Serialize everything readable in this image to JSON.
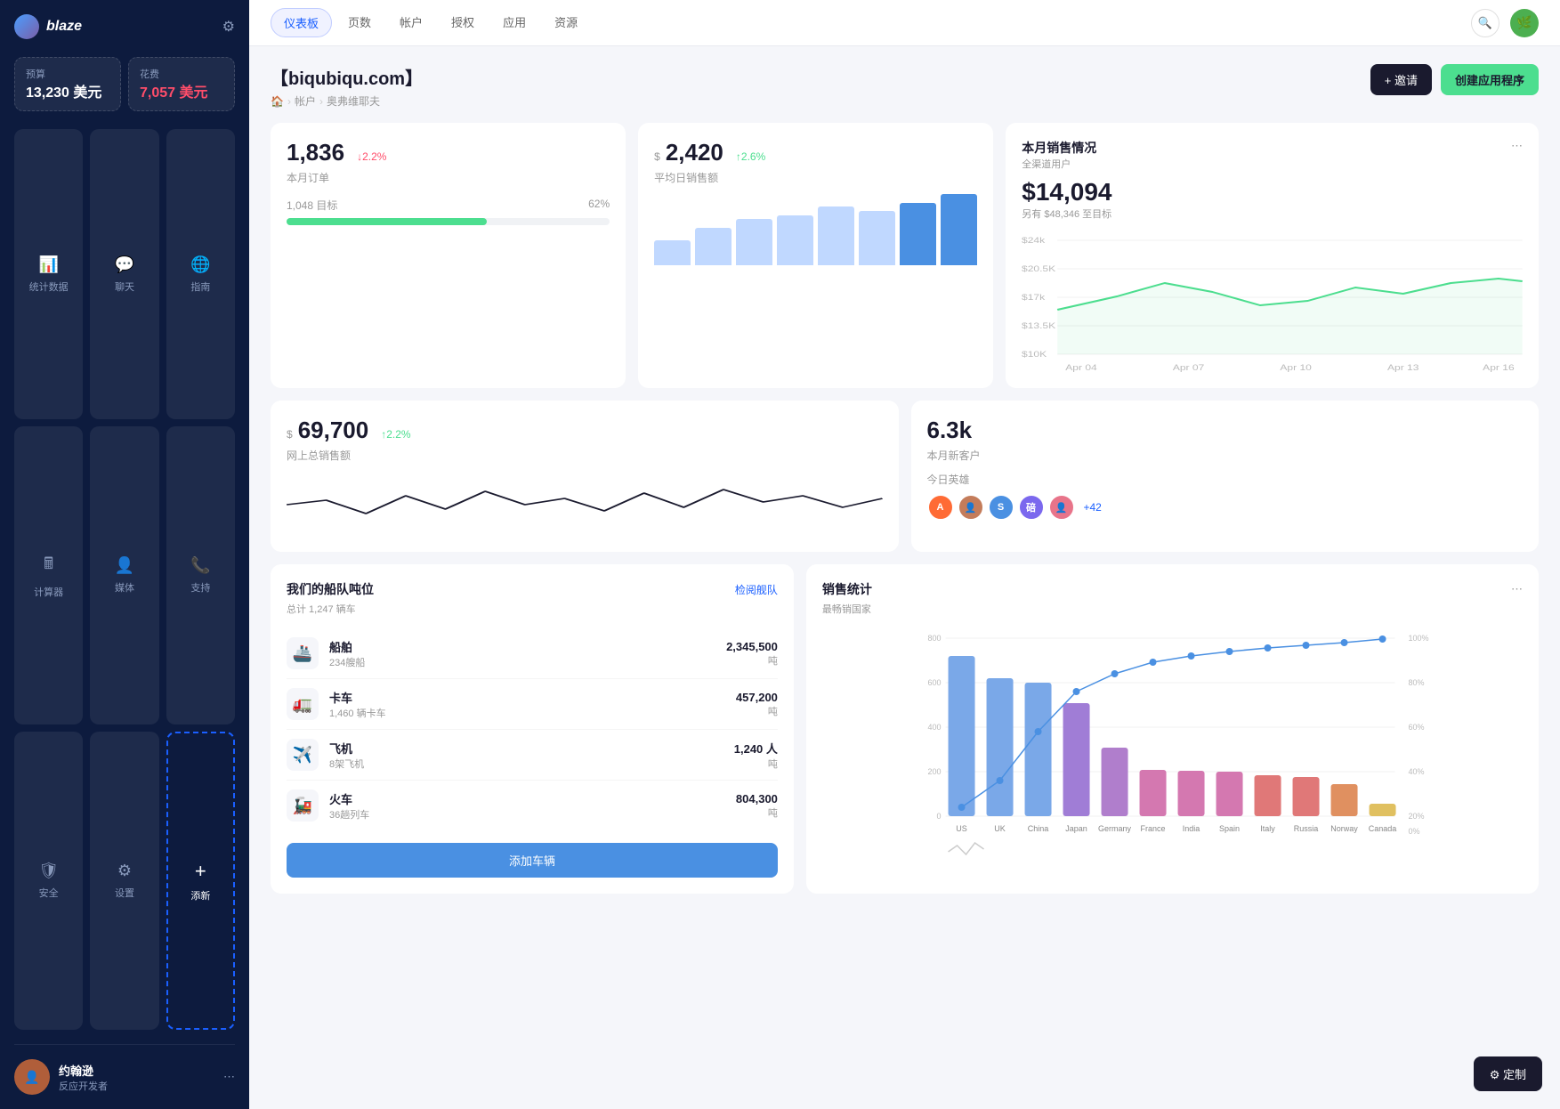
{
  "sidebar": {
    "logo_text": "blaze",
    "budget": {
      "label": "预算",
      "value": "13,230 美元"
    },
    "expense": {
      "label": "花费",
      "value": "7,057 美元"
    },
    "nav_items": [
      {
        "id": "stats",
        "label": "统计数据",
        "icon": "📊"
      },
      {
        "id": "chat",
        "label": "聊天",
        "icon": "💬"
      },
      {
        "id": "guide",
        "label": "指南",
        "icon": "🌐"
      },
      {
        "id": "calc",
        "label": "计算器",
        "icon": "🖩"
      },
      {
        "id": "media",
        "label": "媒体",
        "icon": "👤"
      },
      {
        "id": "support",
        "label": "支持",
        "icon": "📞"
      },
      {
        "id": "security",
        "label": "安全",
        "icon": "🛡"
      },
      {
        "id": "settings",
        "label": "设置",
        "icon": "⚙"
      },
      {
        "id": "add",
        "label": "添新",
        "icon": "+"
      }
    ],
    "user": {
      "name": "约翰逊",
      "role": "反应开发者"
    }
  },
  "topnav": {
    "tabs": [
      {
        "id": "dashboard",
        "label": "仪表板",
        "active": true
      },
      {
        "id": "pages",
        "label": "页数"
      },
      {
        "id": "accounts",
        "label": "帐户"
      },
      {
        "id": "auth",
        "label": "授权"
      },
      {
        "id": "apps",
        "label": "应用"
      },
      {
        "id": "resources",
        "label": "资源"
      }
    ]
  },
  "page": {
    "title": "【biqubiqu.com】",
    "breadcrumb": [
      "🏠",
      "帐户",
      "奥弗维耶夫"
    ],
    "actions": {
      "invite": "+ 邀请",
      "create": "创建应用程序"
    }
  },
  "stats": {
    "orders": {
      "value": "1,836",
      "change": "↓2.2%",
      "change_dir": "down",
      "label": "本月订单",
      "target_label": "1,048 目标",
      "target_pct": "62%",
      "bar_pct": 62
    },
    "avg_sales": {
      "prefix": "$",
      "value": "2,420",
      "change": "↑2.6%",
      "change_dir": "up",
      "label": "平均日销售额",
      "bars": [
        30,
        45,
        55,
        60,
        70,
        65,
        75,
        85
      ]
    },
    "monthly_sales": {
      "title": "本月销售情况",
      "subtitle": "全渠道用户",
      "value": "$14,094",
      "target_text": "另有 $48,346 至目标",
      "y_labels": [
        "$24k",
        "$20.5K",
        "$17k",
        "$13.5K",
        "$10K"
      ],
      "x_labels": [
        "Apr 04",
        "Apr 07",
        "Apr 10",
        "Apr 13",
        "Apr 16"
      ]
    }
  },
  "stats2": {
    "total_sales": {
      "prefix": "$",
      "value": "69,700",
      "change": "↑2.2%",
      "change_dir": "up",
      "label": "网上总销售额"
    },
    "new_customers": {
      "value": "6.3k",
      "label": "本月新客户",
      "heroes_label": "今日英雄",
      "heroes_count": "+42"
    }
  },
  "fleet": {
    "title": "我们的船队吨位",
    "subtitle": "总计 1,247 辆车",
    "link": "检阅舰队",
    "items": [
      {
        "icon": "🚢",
        "name": "船舶",
        "sub": "234艘船",
        "value": "2,345,500",
        "unit": "吨"
      },
      {
        "icon": "🚛",
        "name": "卡车",
        "sub": "1,460 辆卡车",
        "value": "457,200",
        "unit": "吨"
      },
      {
        "icon": "✈️",
        "name": "飞机",
        "sub": "8架飞机",
        "value": "1,240 人",
        "unit": "吨"
      },
      {
        "icon": "🚂",
        "name": "火车",
        "sub": "36趟列车",
        "value": "804,300",
        "unit": "吨"
      }
    ],
    "add_btn": "添加车辆"
  },
  "sales_chart": {
    "title": "销售统计",
    "subtitle": "最畅销国家",
    "countries": [
      "US",
      "UK",
      "China",
      "Japan",
      "Germany",
      "France",
      "India",
      "Spain",
      "Italy",
      "Russia",
      "Norway",
      "Canada"
    ],
    "values": [
      720,
      620,
      600,
      510,
      310,
      210,
      205,
      200,
      185,
      175,
      145,
      55
    ],
    "more_btn": "..."
  },
  "customize_btn": "⚙ 定制"
}
